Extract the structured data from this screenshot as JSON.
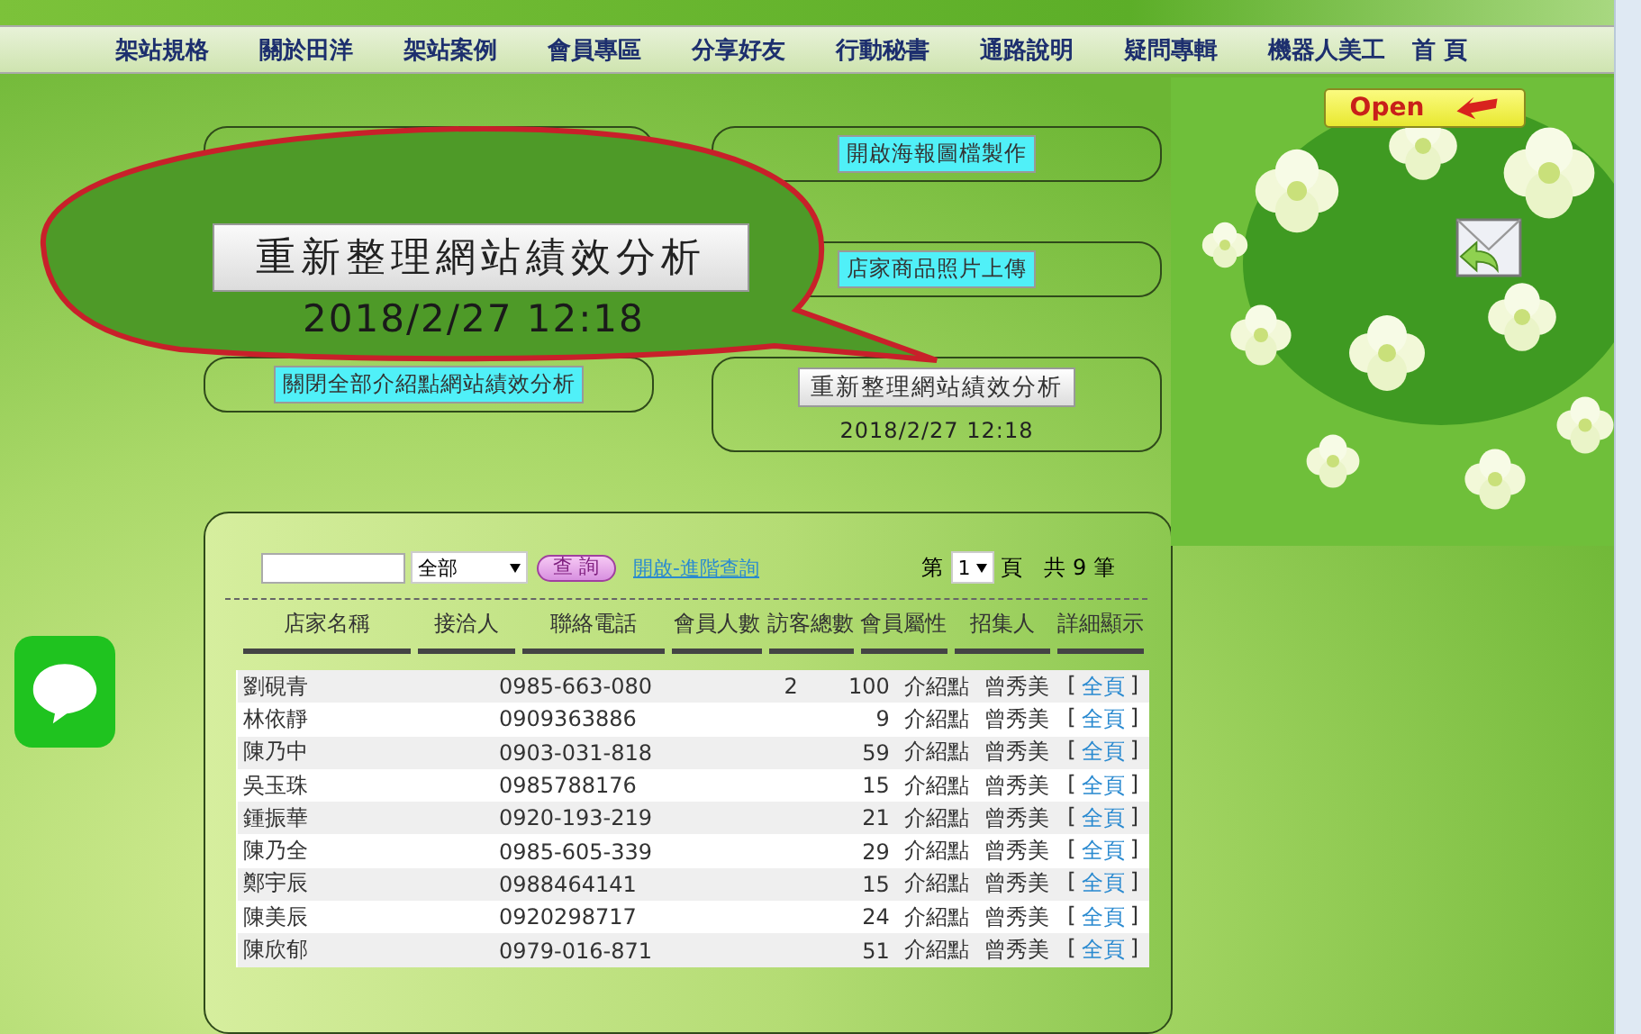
{
  "nav": [
    "架站規格",
    "關於田洋",
    "架站案例",
    "會員專區",
    "分享好友",
    "行動秘書",
    "通路說明",
    "疑問專輯",
    "機器人美工",
    "首 頁"
  ],
  "open_button": "Open",
  "left_panels": [
    {
      "kind": "frame"
    },
    {
      "kind": "button",
      "label": "關閉全部介紹點網站績效分析"
    }
  ],
  "right_panels": [
    {
      "kind": "button",
      "label": "開啟海報圖檔製作"
    },
    {
      "kind": "button",
      "label": "店家商品照片上傳"
    },
    {
      "kind": "refresh",
      "label": "重新整理網站績效分析",
      "time": "2018/2/27 12:18"
    }
  ],
  "callout": {
    "label": "重新整理網站績效分析",
    "time": "2018/2/27 12:18"
  },
  "toolbar": {
    "filter": "全部",
    "search_button": "查 詢",
    "advanced_link": "開啟-進階查詢",
    "page_prefix": "第",
    "page": "1",
    "page_suffix": "頁",
    "total": "共 9 筆"
  },
  "table": {
    "columns": [
      "店家名稱",
      "接洽人",
      "聯絡電話",
      "會員人數",
      "訪客總數",
      "會員屬性",
      "招集人",
      "詳細顯示"
    ],
    "rows": [
      {
        "name": "劉硯青",
        "phone": "0985-663-080",
        "members": "2",
        "visitors": "100",
        "type": "介紹點",
        "recruiter": "曾秀美",
        "open": "[",
        "detail": "全頁",
        "close": "]"
      },
      {
        "name": "林依靜",
        "phone": "0909363886",
        "visitors": "9",
        "type": "介紹點",
        "recruiter": "曾秀美",
        "open": "[",
        "detail": "全頁",
        "close": "]"
      },
      {
        "name": "陳乃中",
        "phone": "0903-031-818",
        "visitors": "59",
        "type": "介紹點",
        "recruiter": "曾秀美",
        "open": "[",
        "detail": "全頁",
        "close": "]"
      },
      {
        "name": "吳玉珠",
        "phone": "0985788176",
        "visitors": "15",
        "type": "介紹點",
        "recruiter": "曾秀美",
        "open": "[",
        "detail": "全頁",
        "close": "]"
      },
      {
        "name": "鍾振華",
        "phone": "0920-193-219",
        "visitors": "21",
        "type": "介紹點",
        "recruiter": "曾秀美",
        "open": "[",
        "detail": "全頁",
        "close": "]"
      },
      {
        "name": "陳乃全",
        "phone": "0985-605-339",
        "visitors": "29",
        "type": "介紹點",
        "recruiter": "曾秀美",
        "open": "[",
        "detail": "全頁",
        "close": "]"
      },
      {
        "name": "鄭宇辰",
        "phone": "0988464141",
        "visitors": "15",
        "type": "介紹點",
        "recruiter": "曾秀美",
        "open": "[",
        "detail": "全頁",
        "close": "]"
      },
      {
        "name": "陳美辰",
        "phone": "0920298717",
        "visitors": "24",
        "type": "介紹點",
        "recruiter": "曾秀美",
        "open": "[",
        "detail": "全頁",
        "close": "]"
      },
      {
        "name": "陳欣郁",
        "phone": "0979-016-871",
        "visitors": "51",
        "type": "介紹點",
        "recruiter": "曾秀美",
        "open": "[",
        "detail": "全頁",
        "close": "]"
      }
    ]
  }
}
